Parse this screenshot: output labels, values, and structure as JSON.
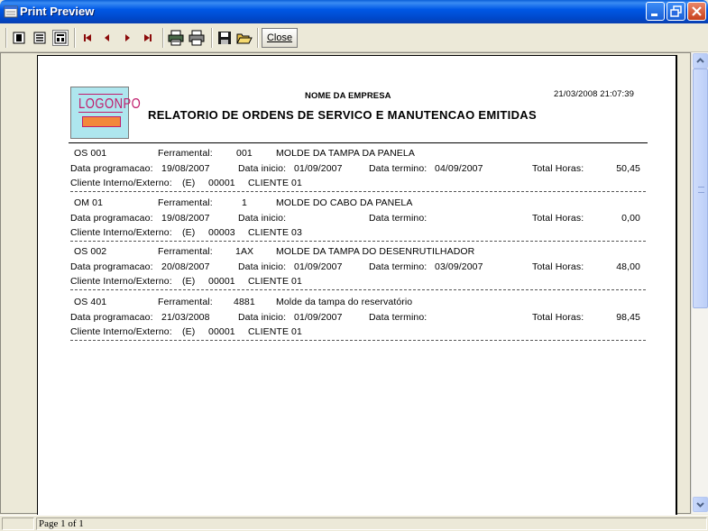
{
  "window": {
    "title": "Print Preview"
  },
  "toolbar": {
    "buttons": [
      {
        "icon": "single-page-icon"
      },
      {
        "icon": "multi-page-icon"
      },
      {
        "icon": "page-width-icon"
      },
      {
        "icon": "first-page-icon"
      },
      {
        "icon": "previous-page-icon"
      },
      {
        "icon": "next-page-icon"
      },
      {
        "icon": "last-page-icon"
      },
      {
        "icon": "print-setup-icon"
      },
      {
        "icon": "print-icon"
      },
      {
        "icon": "save-icon"
      },
      {
        "icon": "open-icon"
      }
    ],
    "close_label": "Close"
  },
  "report": {
    "logo_text": "LOGONPO",
    "company": "NOME DA EMPRESA",
    "datetime": "21/03/2008 21:07:39",
    "title": "RELATORIO DE ORDENS DE SERVICO E MANUTENCAO EMITIDAS",
    "labels": {
      "ferramental": "Ferramental:",
      "data_programacao": "Data programacao:",
      "data_inicio": "Data inicio:",
      "data_termino": "Data termino:",
      "total_horas": "Total Horas:",
      "cliente": "Cliente Interno/Externo:"
    },
    "records": [
      {
        "os": "OS  001",
        "ferramental_code": "001",
        "description": "MOLDE DA TAMPA DA PANELA",
        "data_programacao": "19/08/2007",
        "data_inicio": "01/09/2007",
        "data_termino": "04/09/2007",
        "total_horas": "50,45",
        "cliente_tipo": "(E)",
        "cliente_codigo": "00001",
        "cliente_nome": "CLIENTE 01"
      },
      {
        "os": "OM  01",
        "ferramental_code": "1",
        "description": "MOLDE DO CABO DA PANELA",
        "data_programacao": "19/08/2007",
        "data_inicio": "",
        "data_termino": "",
        "total_horas": "0,00",
        "cliente_tipo": "(E)",
        "cliente_codigo": "00003",
        "cliente_nome": "CLIENTE 03"
      },
      {
        "os": "OS  002",
        "ferramental_code": "1AX",
        "description": "MOLDE DA TAMPA DO DESENRUTILHADOR",
        "data_programacao": "20/08/2007",
        "data_inicio": "01/09/2007",
        "data_termino": "03/09/2007",
        "total_horas": "48,00",
        "cliente_tipo": "(E)",
        "cliente_codigo": "00001",
        "cliente_nome": "CLIENTE 01"
      },
      {
        "os": "OS  401",
        "ferramental_code": "4881",
        "description": "Molde da tampa do reservatório",
        "data_programacao": "21/03/2008",
        "data_inicio": "01/09/2007",
        "data_termino": "",
        "total_horas": "98,45",
        "cliente_tipo": "(E)",
        "cliente_codigo": "00001",
        "cliente_nome": "CLIENTE 01"
      }
    ]
  },
  "status": {
    "page_text": "Page 1 of 1"
  }
}
